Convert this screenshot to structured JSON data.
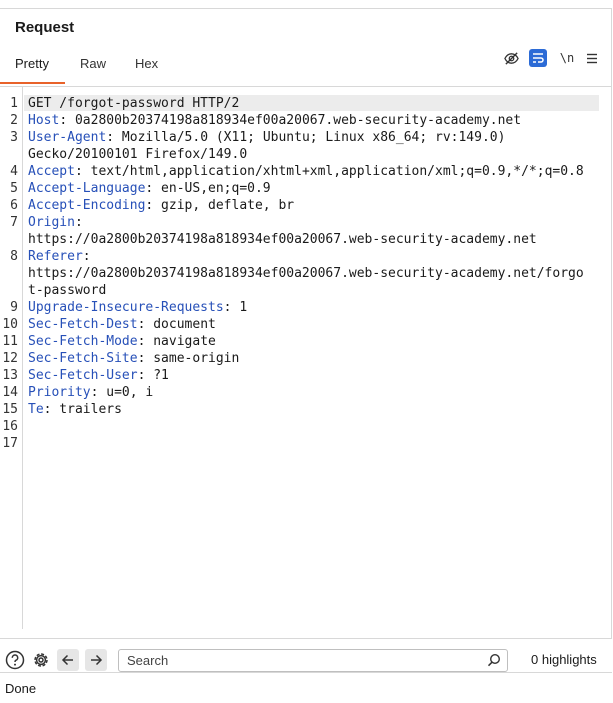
{
  "panel": {
    "title": "Request"
  },
  "tabs": [
    {
      "label": "Pretty",
      "active": true
    },
    {
      "label": "Raw",
      "active": false
    },
    {
      "label": "Hex",
      "active": false
    }
  ],
  "toolbar": {
    "hide_icon": "eye-slash-icon",
    "wrap_icon": "word-wrap-icon",
    "newline_label": "\\n",
    "menu_icon": "hamburger-menu-icon",
    "accent_color": "#e8622a",
    "wrap_active_color": "#2c6bd6"
  },
  "editor": {
    "line_numbers": [
      "1",
      "2",
      "3",
      "",
      "4",
      "5",
      "6",
      "7",
      "",
      "8",
      "",
      "",
      "9",
      "10",
      "11",
      "12",
      "13",
      "14",
      "15",
      "16",
      "17"
    ],
    "lines": {
      "l1": "GET /forgot-password HTTP/2",
      "l2_name": "Host",
      "l2_value": ": 0a2800b20374198a818934ef00a20067.web-security-academy.net",
      "l3_name": "User-Agent",
      "l3_value": ": Mozilla/5.0 (X11; Ubuntu; Linux x86_64; rv:149.0)",
      "l3_cont": "Gecko/20100101 Firefox/149.0",
      "l4_name": "Accept",
      "l4_value": ": text/html,application/xhtml+xml,application/xml;q=0.9,*/*;q=0.8",
      "l5_name": "Accept-Language",
      "l5_value": ": en-US,en;q=0.9",
      "l6_name": "Accept-Encoding",
      "l6_value": ": gzip, deflate, br",
      "l7_name": "Origin",
      "l7_value": ":",
      "l7_cont": "https://0a2800b20374198a818934ef00a20067.web-security-academy.net",
      "l8_name": "Referer",
      "l8_value": ":",
      "l8_cont1": "https://0a2800b20374198a818934ef00a20067.web-security-academy.net/forgo",
      "l8_cont2": "t-password",
      "l9_name": "Upgrade-Insecure-Requests",
      "l9_value": ": 1",
      "l10_name": "Sec-Fetch-Dest",
      "l10_value": ": document",
      "l11_name": "Sec-Fetch-Mode",
      "l11_value": ": navigate",
      "l12_name": "Sec-Fetch-Site",
      "l12_value": ": same-origin",
      "l13_name": "Sec-Fetch-User",
      "l13_value": ": ?1",
      "l14_name": "Priority",
      "l14_value": ": u=0, i",
      "l15_name": "Te",
      "l15_value": ": trailers"
    },
    "header_name_color": "#2750b8"
  },
  "bottom": {
    "help_icon": "help-circle-icon",
    "settings_icon": "gear-icon",
    "back_icon": "arrow-left-icon",
    "forward_icon": "arrow-right-icon",
    "search_placeholder": "Search",
    "search_value": "",
    "highlights_label": "0 highlights"
  },
  "status": {
    "text": "Done"
  }
}
